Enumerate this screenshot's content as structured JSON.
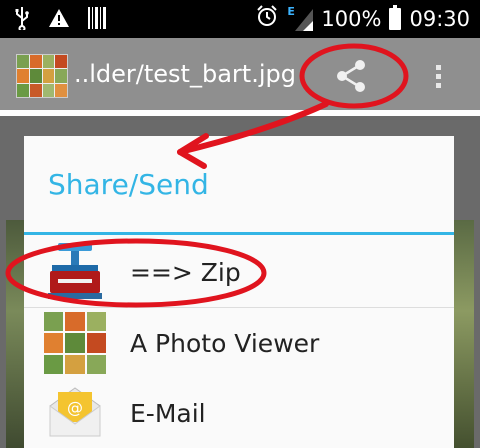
{
  "status_bar": {
    "battery": "100%",
    "time": "09:30",
    "network_type": "E",
    "icons": [
      "usb-icon",
      "warning-icon",
      "barcode-icon",
      "alarm-icon",
      "signal-icon",
      "battery-icon"
    ]
  },
  "action_bar": {
    "title": "..lder/test_bart.jpg",
    "share_icon": "share-icon",
    "menu_icon": "overflow-menu-icon"
  },
  "dialog": {
    "title": "Share/Send",
    "items": [
      {
        "label": "==> Zip",
        "icon": "zip-press-icon"
      },
      {
        "label": "A Photo Viewer",
        "icon": "photo-grid-icon"
      },
      {
        "label": "E-Mail",
        "icon": "email-icon"
      }
    ]
  },
  "colors": {
    "accent": "#33b5e5",
    "action_bar": "#8f8f8f",
    "annotation": "#e0141e"
  }
}
